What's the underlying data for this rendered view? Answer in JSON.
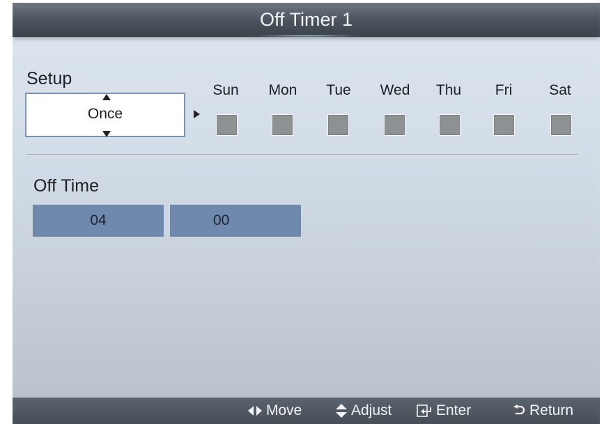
{
  "title": "Off Timer 1",
  "setup": {
    "label": "Setup",
    "value": "Once"
  },
  "days": [
    "Sun",
    "Mon",
    "Tue",
    "Wed",
    "Thu",
    "Fri",
    "Sat"
  ],
  "off_time": {
    "label": "Off Time",
    "hour": "04",
    "minute": "00"
  },
  "hints": {
    "move": "Move",
    "adjust": "Adjust",
    "enter": "Enter",
    "return": "Return"
  },
  "colors": {
    "title_bar": "#4a525c",
    "field_fill": "#6f89ad",
    "checkbox": "#8e9194"
  },
  "icons": [
    "left-right-arrows-icon",
    "up-down-arrows-icon",
    "enter-icon",
    "return-icon",
    "arrow-up-icon",
    "arrow-down-icon",
    "arrow-right-icon"
  ]
}
